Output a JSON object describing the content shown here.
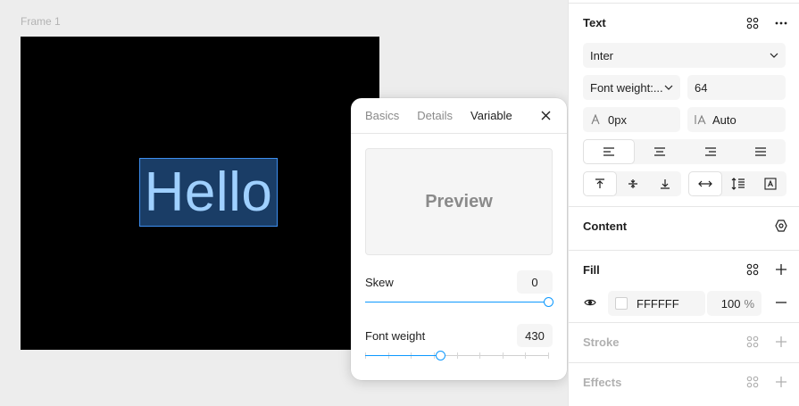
{
  "canvas": {
    "frame_label": "Frame 1",
    "text_layer": "Hello"
  },
  "popover": {
    "tabs": [
      {
        "label": "Basics",
        "active": false
      },
      {
        "label": "Details",
        "active": false
      },
      {
        "label": "Variable",
        "active": true
      }
    ],
    "preview_label": "Preview",
    "skew": {
      "label": "Skew",
      "value": "0",
      "slider_fraction": 1.0
    },
    "font_weight": {
      "label": "Font weight",
      "value": "430",
      "slider_fraction": 0.41
    }
  },
  "panel": {
    "text_section": {
      "title": "Text",
      "font_family": "Inter",
      "font_weight_label": "Font weight:...",
      "font_size": "64",
      "letter_spacing": "0px",
      "line_height": "Auto",
      "align_horizontal": [
        "left",
        "center",
        "right",
        "justify"
      ],
      "align_horizontal_active": "left",
      "align_vertical": [
        "top",
        "middle",
        "bottom"
      ],
      "align_vertical_active": "top",
      "resizing": [
        "auto-width",
        "auto-height",
        "fixed"
      ],
      "resizing_active": "auto-width"
    },
    "content_section": {
      "title": "Content"
    },
    "fill_section": {
      "title": "Fill",
      "color_hex": "FFFFFF",
      "opacity": "100",
      "opacity_unit": "%"
    },
    "stroke_section": {
      "title": "Stroke"
    },
    "effects_section": {
      "title": "Effects"
    }
  },
  "colors": {
    "accent": "#0d99ff",
    "selection_fill": "#1a3d66",
    "text_layer_color": "#9fd0ff",
    "fill_color": "#FFFFFF"
  }
}
